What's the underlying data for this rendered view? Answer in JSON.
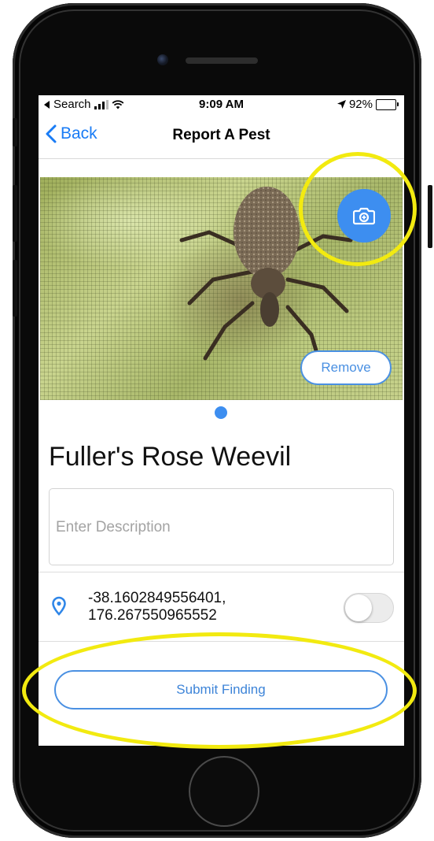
{
  "status_bar": {
    "back_app": "Search",
    "time": "9:09 AM",
    "battery": "92%",
    "battery_level": 0.92
  },
  "nav": {
    "back_label": "Back",
    "title": "Report A Pest"
  },
  "photo": {
    "remove_label": "Remove",
    "page_count": 1,
    "current_page": 1
  },
  "pest": {
    "name": "Fuller's Rose Weevil"
  },
  "description": {
    "value": "",
    "placeholder": "Enter Description"
  },
  "location": {
    "latitude": "-38.1602849556401,",
    "longitude": "176.267550965552",
    "toggle_on": false
  },
  "actions": {
    "submit_label": "Submit Finding"
  },
  "colors": {
    "accent": "#3d8ef0",
    "highlight": "#f2ea10"
  }
}
